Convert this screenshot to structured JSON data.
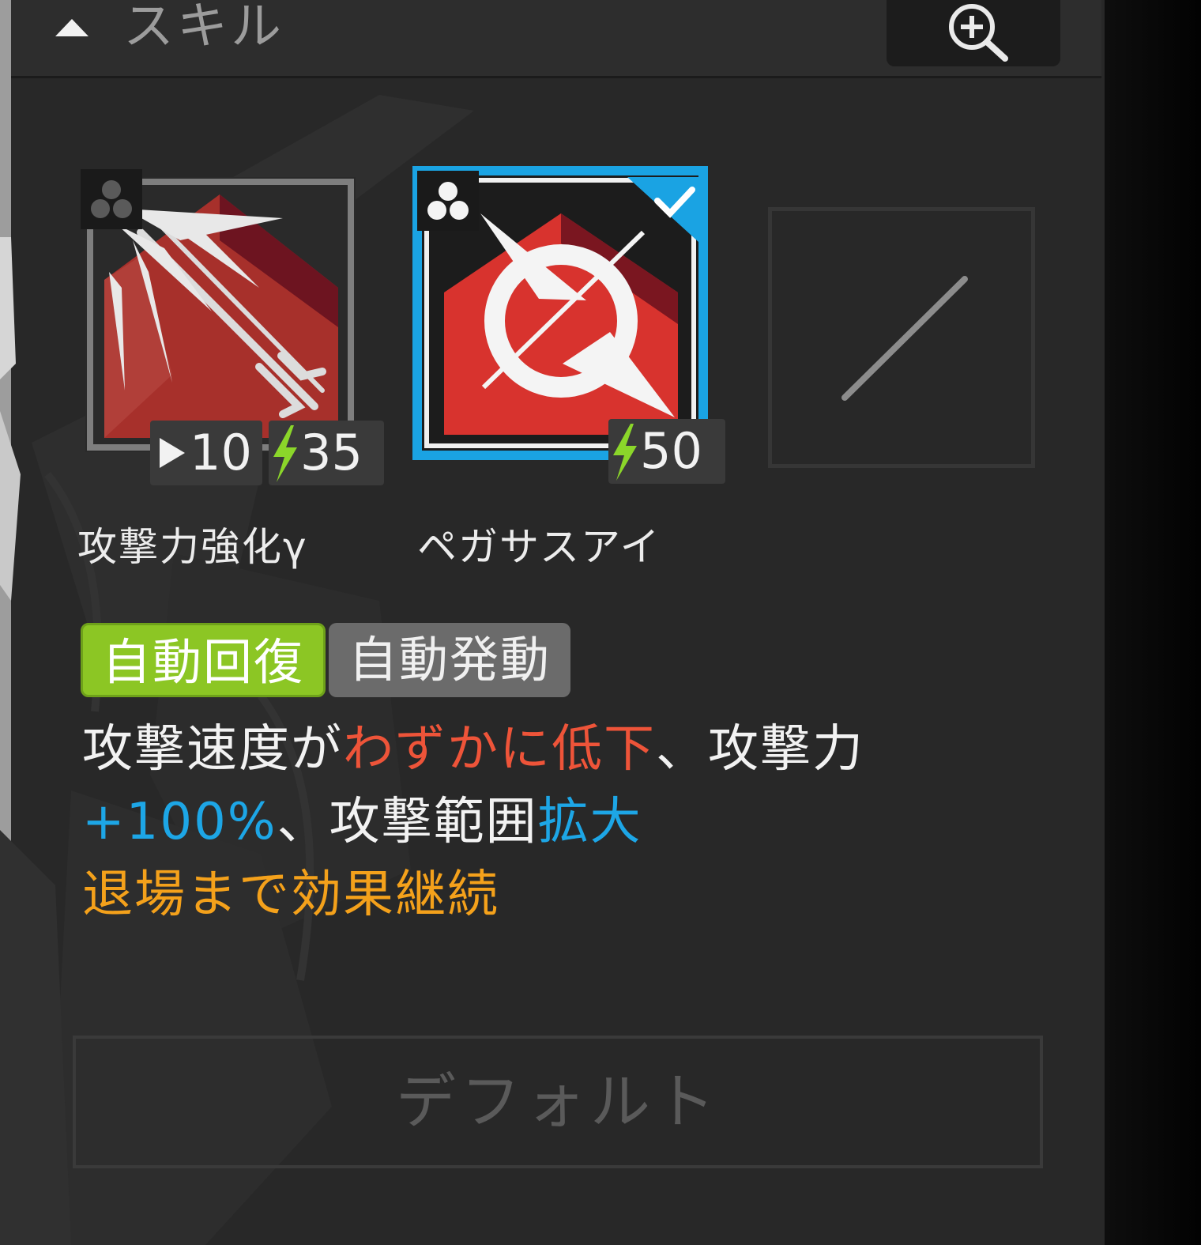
{
  "header": {
    "title": "スキル",
    "collapse_icon": "triangle-up-icon",
    "zoom_icon": "zoom-in-icon"
  },
  "skills": [
    {
      "name": "攻撃力強化γ",
      "icon": "arrow-burst-skill-icon",
      "type_icon": "three-dots-icon",
      "selected": false,
      "stats": [
        {
          "icon": "play-icon",
          "value": "10"
        },
        {
          "icon": "lightning-icon",
          "value": "35"
        }
      ]
    },
    {
      "name": "ペガサスアイ",
      "icon": "pegasus-eye-skill-icon",
      "type_icon": "three-dots-icon",
      "selected": true,
      "stats": [
        {
          "icon": "lightning-icon",
          "value": "50"
        }
      ]
    }
  ],
  "empty_slot": {
    "icon": "empty-slash-icon"
  },
  "tags": {
    "auto_recovery": "自動回復",
    "auto_trigger": "自動発動"
  },
  "description": {
    "part1": "攻撃速度が",
    "part2": "わずかに低下",
    "part3": "、攻撃力",
    "part4": "+100%",
    "part5": "、攻撃範囲",
    "part6": "拡大",
    "line2": "退場まで効果継続"
  },
  "default_button": {
    "label": "デフォルト"
  },
  "colors": {
    "tag_green": "#8cc624",
    "tag_gray": "#6b6b6b",
    "selected_border": "#1aa3e3",
    "lightning": "#8bd62a",
    "text_red": "#ee5439",
    "text_blue": "#1da6e6",
    "text_orange": "#f4a11b"
  }
}
